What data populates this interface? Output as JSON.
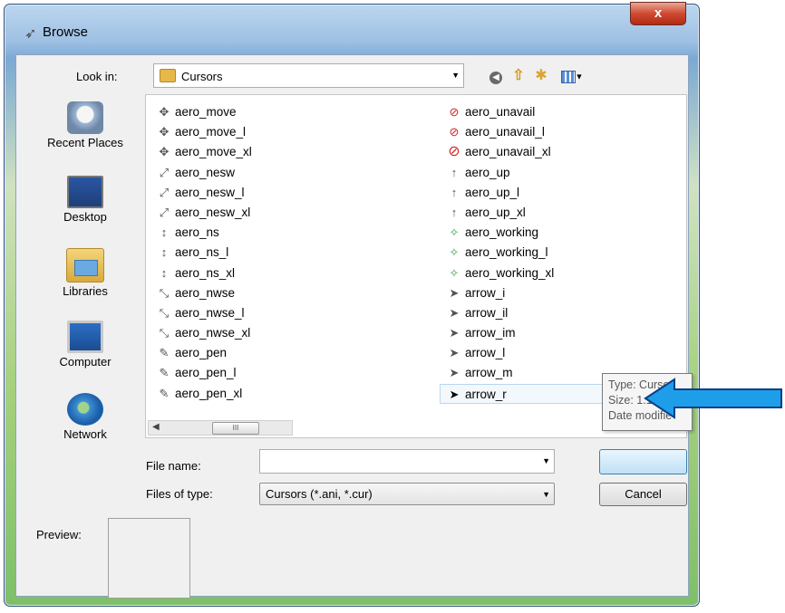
{
  "window": {
    "title": "Browse",
    "close_symbol": "x"
  },
  "lookin": {
    "label": "Look in:",
    "value": "Cursors"
  },
  "places": [
    {
      "label": "Recent Places"
    },
    {
      "label": "Desktop"
    },
    {
      "label": "Libraries"
    },
    {
      "label": "Computer"
    },
    {
      "label": "Network"
    }
  ],
  "files": {
    "column1": [
      "aero_move",
      "aero_move_l",
      "aero_move_xl",
      "aero_nesw",
      "aero_nesw_l",
      "aero_nesw_xl",
      "aero_ns",
      "aero_ns_l",
      "aero_ns_xl",
      "aero_nwse",
      "aero_nwse_l",
      "aero_nwse_xl",
      "aero_pen",
      "aero_pen_l",
      "aero_pen_xl"
    ],
    "column2": [
      "aero_unavail",
      "aero_unavail_l",
      "aero_unavail_xl",
      "aero_up",
      "aero_up_l",
      "aero_up_xl",
      "aero_working",
      "aero_working_l",
      "aero_working_xl",
      "arrow_i",
      "arrow_il",
      "arrow_im",
      "arrow_l",
      "arrow_m",
      "arrow_r"
    ],
    "selected": "arrow_r"
  },
  "scrollbar": {
    "thumb_grip": "III"
  },
  "filename": {
    "label": "File name:",
    "value": ""
  },
  "filetype": {
    "label": "Files of type:",
    "value": "Cursors (*.ani, *.cur)"
  },
  "buttons": {
    "open": "",
    "cancel": "Cancel"
  },
  "tooltip": {
    "line1": "Type: Cursor",
    "line2": "Size: 1.13 KB",
    "line3": "Date modifie"
  },
  "preview": {
    "label": "Preview:"
  },
  "colors": {
    "pointer_arrow": "#1e9ee8",
    "titlebar": "#9fc1e4",
    "close_button": "#cf4a31"
  }
}
